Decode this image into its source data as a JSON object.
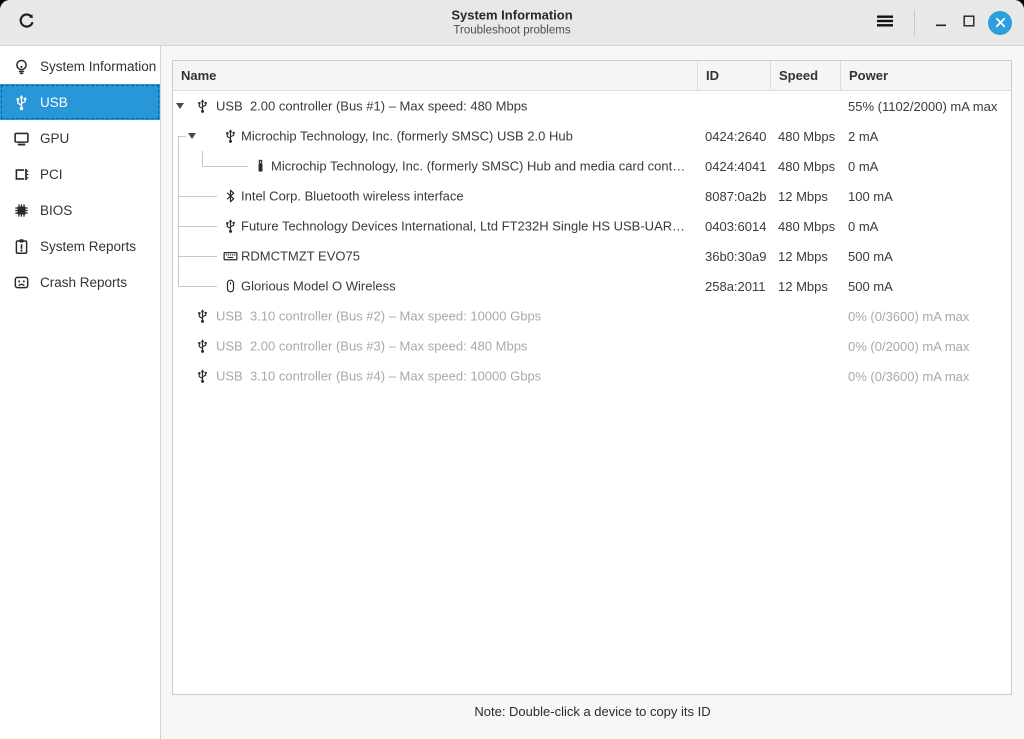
{
  "window": {
    "title": "System Information",
    "subtitle": "Troubleshoot problems"
  },
  "titlebar": {
    "buttons": [
      "refresh",
      "menu",
      "minimize",
      "maximize",
      "close"
    ],
    "close_color": "#2d9fdd"
  },
  "sidebar": {
    "selected": "USB",
    "selected_color": "#2897d7",
    "items": [
      {
        "label": "System Information",
        "icon": "lightbulb",
        "selected": false
      },
      {
        "label": "USB",
        "icon": "usb",
        "selected": true
      },
      {
        "label": "GPU",
        "icon": "monitor",
        "selected": false
      },
      {
        "label": "PCI",
        "icon": "pci-card",
        "selected": false
      },
      {
        "label": "BIOS",
        "icon": "chip",
        "selected": false
      },
      {
        "label": "System Reports",
        "icon": "report",
        "selected": false
      },
      {
        "label": "Crash Reports",
        "icon": "crash-face",
        "selected": false
      }
    ]
  },
  "table": {
    "columns": [
      "Name",
      "ID",
      "Speed",
      "Power"
    ],
    "rows": [
      {
        "depth": 0,
        "expander": true,
        "first": false,
        "last": false,
        "icon": "usb",
        "name": "USB  2.00 controller (Bus #1) – Max speed: 480 Mbps",
        "id": "",
        "speed": "",
        "power": "55% (1102/2000) mA max",
        "dim": false
      },
      {
        "depth": 1,
        "expander": true,
        "first": true,
        "last": false,
        "icon": "usb",
        "name": "Microchip Technology, Inc. (formerly SMSC) USB 2.0 Hub",
        "id": "0424:2640",
        "speed": "480 Mbps",
        "power": "2 mA",
        "dim": false
      },
      {
        "depth": 2,
        "expander": false,
        "first": false,
        "last": true,
        "icon": "usb-stick",
        "name": "Microchip Technology, Inc. (formerly SMSC) Hub and media card cont…",
        "id": "0424:4041",
        "speed": "480 Mbps",
        "power": "0 mA",
        "dim": false
      },
      {
        "depth": 1,
        "expander": false,
        "first": false,
        "last": false,
        "icon": "bluetooth",
        "name": "Intel Corp. Bluetooth wireless interface",
        "id": "8087:0a2b",
        "speed": "12 Mbps",
        "power": "100 mA",
        "dim": false
      },
      {
        "depth": 1,
        "expander": false,
        "first": false,
        "last": false,
        "icon": "usb",
        "name": "Future Technology Devices International, Ltd FT232H Single HS USB-UART…",
        "id": "0403:6014",
        "speed": "480 Mbps",
        "power": "0 mA",
        "dim": false
      },
      {
        "depth": 1,
        "expander": false,
        "first": false,
        "last": false,
        "icon": "keyboard",
        "name": "RDMCTMZT EVO75",
        "id": "36b0:30a9",
        "speed": "12 Mbps",
        "power": "500 mA",
        "dim": false
      },
      {
        "depth": 1,
        "expander": false,
        "first": false,
        "last": true,
        "icon": "mouse",
        "name": "Glorious Model O Wireless",
        "id": "258a:2011",
        "speed": "12 Mbps",
        "power": "500 mA",
        "dim": false
      },
      {
        "depth": 0,
        "expander": false,
        "first": false,
        "last": false,
        "icon": "usb",
        "name": "USB  3.10 controller (Bus #2) – Max speed: 10000 Gbps",
        "id": "",
        "speed": "",
        "power": "0% (0/3600) mA max",
        "dim": true
      },
      {
        "depth": 0,
        "expander": false,
        "first": false,
        "last": false,
        "icon": "usb",
        "name": "USB  2.00 controller (Bus #3) – Max speed: 480 Mbps",
        "id": "",
        "speed": "",
        "power": "0% (0/2000) mA max",
        "dim": true
      },
      {
        "depth": 0,
        "expander": false,
        "first": false,
        "last": false,
        "icon": "usb",
        "name": "USB  3.10 controller (Bus #4) – Max speed: 10000 Gbps",
        "id": "",
        "speed": "",
        "power": "0% (0/3600) mA max",
        "dim": true
      }
    ]
  },
  "note": "Note: Double-click a device to copy its ID"
}
